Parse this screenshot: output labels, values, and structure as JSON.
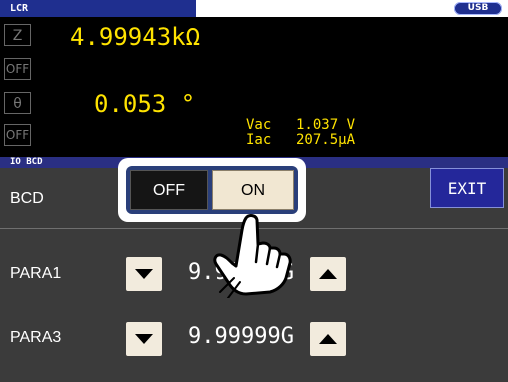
{
  "top_bar": {
    "tab_label": "LCR",
    "usb_label": "USB"
  },
  "measurement": {
    "param1_symbol": "Z",
    "param1_value": "4.99943kΩ",
    "param2_off": "OFF",
    "param3_symbol": "θ",
    "param3_value": "0.053 °",
    "param4_off": "OFF",
    "monitor": {
      "vac_label": "Vac",
      "vac_value": "1.037 V",
      "iac_label": "Iac",
      "iac_value": "207.5μA"
    }
  },
  "io_section": {
    "title": "IO BCD"
  },
  "settings": {
    "bcd_label": "BCD",
    "bcd_toggle": {
      "off_label": "OFF",
      "on_label": "ON",
      "selected": "ON"
    },
    "para1": {
      "label": "PARA1",
      "value": "9.99999G"
    },
    "para3": {
      "label": "PARA3",
      "value": "9.99999G"
    },
    "exit_label": "EXIT"
  },
  "colors": {
    "measurement_text": "#ffe300",
    "header_blue": "#1f2f8f",
    "panel_gray": "#3b3b3b",
    "on_button": "#f1e7d2"
  },
  "icons": [
    "pointing-hand-icon",
    "arrow-down-icon",
    "arrow-up-icon"
  ]
}
